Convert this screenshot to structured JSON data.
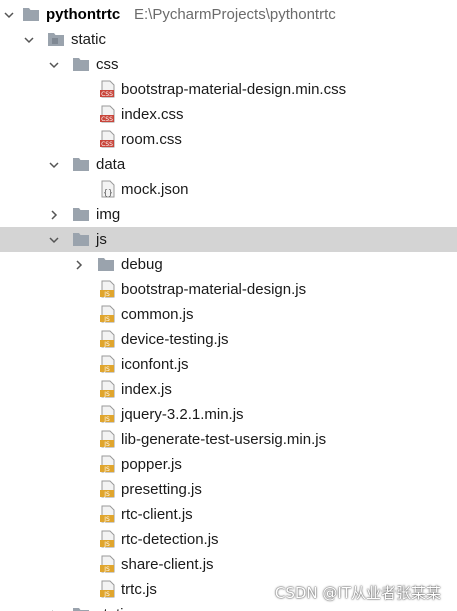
{
  "tree": {
    "root": {
      "name": "pythontrtc",
      "path": "E:\\PycharmProjects\\pythontrtc"
    },
    "static": {
      "name": "static"
    },
    "css": {
      "name": "css",
      "files": [
        "bootstrap-material-design.min.css",
        "index.css",
        "room.css"
      ]
    },
    "data": {
      "name": "data",
      "files": [
        "mock.json"
      ]
    },
    "img": {
      "name": "img"
    },
    "js": {
      "name": "js",
      "debug": "debug",
      "files": [
        "bootstrap-material-design.js",
        "common.js",
        "device-testing.js",
        "iconfont.js",
        "index.js",
        "jquery-3.2.1.min.js",
        "lib-generate-test-usersig.min.js",
        "popper.js",
        "presetting.js",
        "rtc-client.js",
        "rtc-detection.js",
        "share-client.js",
        "trtc.js"
      ]
    },
    "next_partial": "static"
  },
  "watermark": "CSDN @IT从业者张某某",
  "colors": {
    "folder": "#9aa3ad",
    "css_badge": "#c8453a",
    "js_badge": "#e0a52d",
    "selection": "#d4d4d4"
  },
  "icons": {
    "folder": "folder-icon",
    "css": "css-file-icon",
    "js": "js-file-icon",
    "json": "json-file-icon",
    "expanded": "chevron-down-icon",
    "collapsed": "chevron-right-icon"
  }
}
